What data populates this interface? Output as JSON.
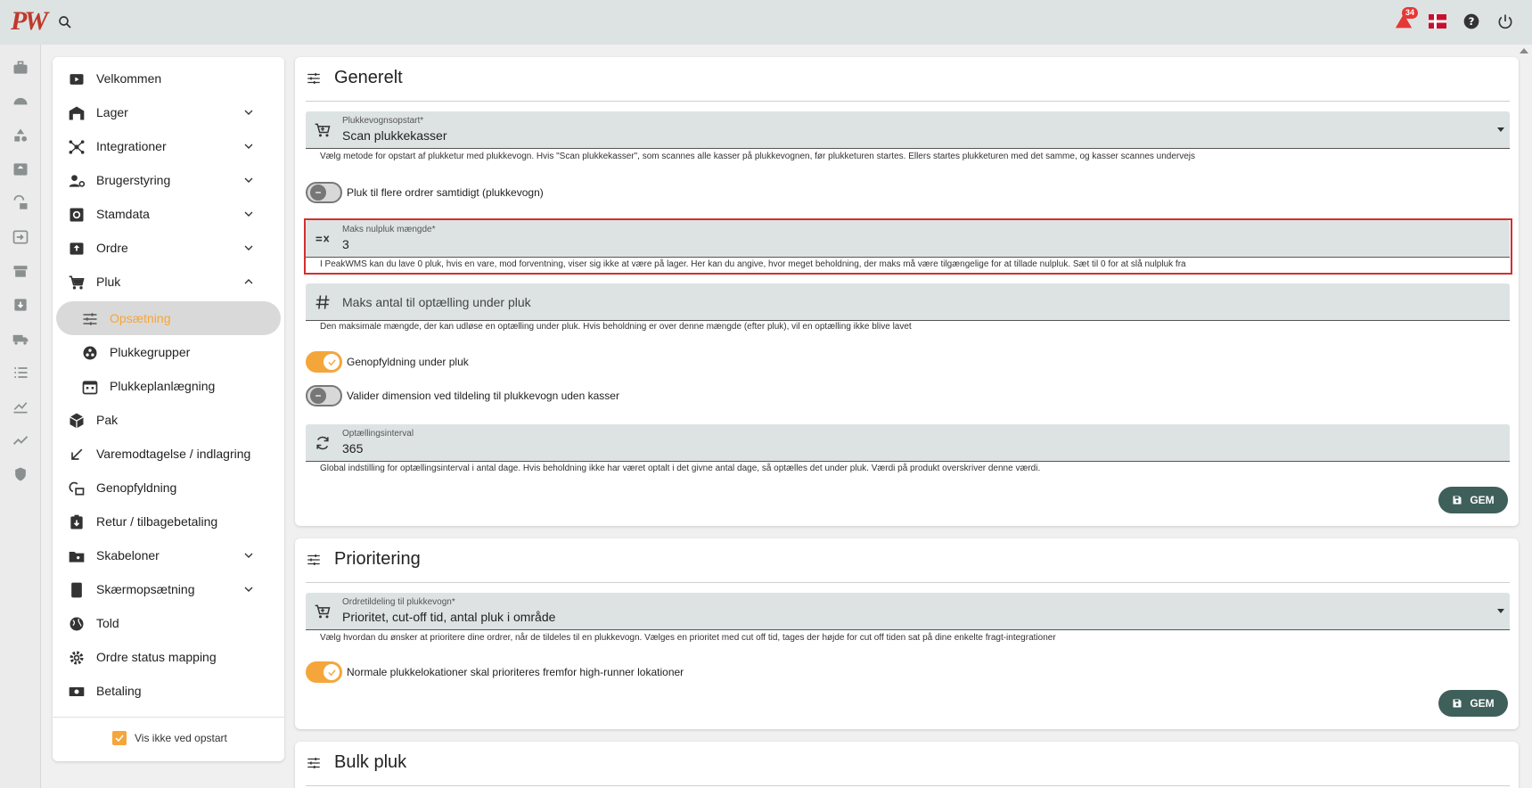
{
  "topbar": {
    "logo_text": "PW",
    "notification_count": "34"
  },
  "sidebar": {
    "items": [
      {
        "label": "Velkommen"
      },
      {
        "label": "Lager"
      },
      {
        "label": "Integrationer"
      },
      {
        "label": "Brugerstyring"
      },
      {
        "label": "Stamdata"
      },
      {
        "label": "Ordre"
      },
      {
        "label": "Pluk"
      },
      {
        "label": "Opsætning"
      },
      {
        "label": "Plukkegrupper"
      },
      {
        "label": "Plukkeplanlægning"
      },
      {
        "label": "Pak"
      },
      {
        "label": "Varemodtagelse / indlagring"
      },
      {
        "label": "Genopfyldning"
      },
      {
        "label": "Retur / tilbagebetaling"
      },
      {
        "label": "Skabeloner"
      },
      {
        "label": "Skærmopsætning"
      },
      {
        "label": "Told"
      },
      {
        "label": "Ordre status mapping"
      },
      {
        "label": "Betaling"
      }
    ],
    "startup_label": "Vis ikke ved opstart",
    "startup_checked": true
  },
  "generelt": {
    "title": "Generelt",
    "cart_start": {
      "label": "Plukkevognsopstart*",
      "value": "Scan plukkekasser",
      "hint": "Vælg metode for opstart af plukketur med plukkevogn. Hvis \"Scan plukkekasser\", som scannes alle kasser på plukkevognen, før plukketuren startes. Ellers startes plukketuren med det samme, og kasser scannes undervejs"
    },
    "multi_orders": {
      "label": "Pluk til flere ordrer samtidigt (plukkevogn)",
      "on": false
    },
    "max_zero_pick": {
      "label": "Maks nulpluk mængde*",
      "value": "3",
      "hint": "I PeakWMS kan du lave 0 pluk, hvis en vare, mod forventning, viser sig ikke at være på lager. Her kan du angive, hvor meget beholdning, der maks må være tilgængelige for at tillade nulpluk. Sæt til 0 for at slå nulpluk fra"
    },
    "max_count": {
      "placeholder": "Maks antal til optælling under pluk",
      "hint": "Den maksimale mængde, der kan udløse en optælling under pluk. Hvis beholdning er over denne mængde (efter pluk), vil en optælling ikke blive lavet"
    },
    "replenish": {
      "label": "Genopfyldning under pluk",
      "on": true
    },
    "validate_dim": {
      "label": "Valider dimension ved tildeling til plukkevogn uden kasser",
      "on": false
    },
    "count_interval": {
      "label": "Optællingsinterval",
      "value": "365",
      "hint": "Global indstilling for optællingsinterval i antal dage. Hvis beholdning ikke har været optalt i det givne antal dage, så optælles det under pluk. Værdi på produkt overskriver denne værdi."
    },
    "save_label": "GEM"
  },
  "prioritering": {
    "title": "Prioritering",
    "order_assign": {
      "label": "Ordretildeling til plukkevogn*",
      "value": "Prioritet, cut-off tid, antal pluk i område",
      "hint": "Vælg hvordan du ønsker at prioritere dine ordrer, når de tildeles til en plukkevogn. Vælges en prioritet med cut off tid, tages der højde for cut off tiden sat på dine enkelte fragt-integrationer"
    },
    "normal_locations": {
      "label": "Normale plukkelokationer skal prioriteres fremfor high-runner lokationer",
      "on": true
    },
    "save_label": "GEM"
  },
  "bulk": {
    "title": "Bulk pluk"
  },
  "colors": {
    "accent": "#f5a63b",
    "brand": "#c0392b",
    "button": "#3f5f5a",
    "field_bg": "#dde3e3"
  }
}
